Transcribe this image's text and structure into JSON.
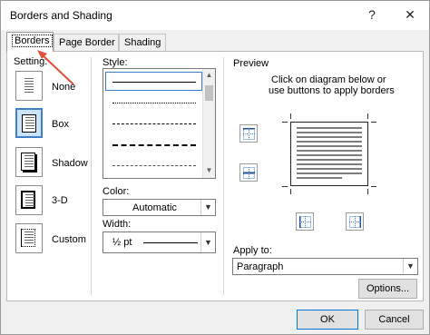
{
  "window": {
    "title": "Borders and Shading",
    "help_label": "?",
    "close_label": "✕"
  },
  "tabs": [
    {
      "label": "Borders",
      "active": true
    },
    {
      "label": "Page Border",
      "active": false
    },
    {
      "label": "Shading",
      "active": false
    }
  ],
  "setting": {
    "label": "Setting:",
    "options": [
      {
        "label": "None",
        "selected": false
      },
      {
        "label": "Box",
        "selected": true
      },
      {
        "label": "Shadow",
        "selected": false
      },
      {
        "label": "3-D",
        "selected": false
      },
      {
        "label": "Custom",
        "selected": false
      }
    ]
  },
  "style": {
    "label": "Style:",
    "options": [
      "solid",
      "dotted",
      "dashed-small",
      "dashed-large",
      "dash-dot"
    ]
  },
  "color": {
    "label": "Color:",
    "value": "Automatic"
  },
  "width": {
    "label": "Width:",
    "value": "½ pt"
  },
  "preview": {
    "label": "Preview",
    "hint_line1": "Click on diagram below or",
    "hint_line2": "use buttons to apply borders"
  },
  "apply_to": {
    "label": "Apply to:",
    "value": "Paragraph"
  },
  "buttons": {
    "options": "Options...",
    "ok": "OK",
    "cancel": "Cancel"
  },
  "colors": {
    "accent": "#3f7fc9",
    "selection_fill": "#cce4f7",
    "annotation_arrow": "#e0503c"
  }
}
